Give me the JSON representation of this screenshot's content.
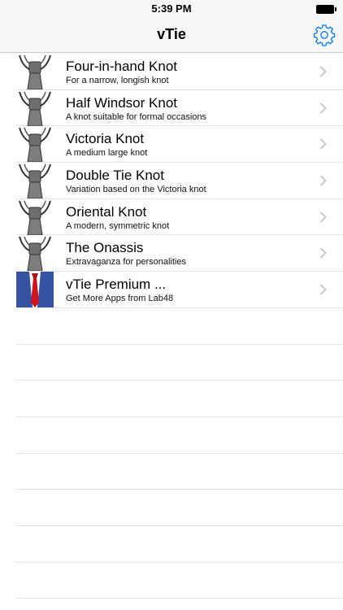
{
  "status_bar": {
    "time": "5:39 PM",
    "battery_icon": "battery-full-icon"
  },
  "nav_bar": {
    "title": "vTie",
    "settings_icon": "gear-icon"
  },
  "knots": [
    {
      "title": "Four-in-hand Knot",
      "subtitle": "For a narrow, longish knot",
      "icon": "tie-knot-icon"
    },
    {
      "title": "Half Windsor Knot",
      "subtitle": "A knot suitable for formal occasions",
      "icon": "tie-knot-icon"
    },
    {
      "title": "Victoria Knot",
      "subtitle": "A medium large knot",
      "icon": "tie-knot-icon"
    },
    {
      "title": "Double Tie Knot",
      "subtitle": "Variation based on the Victoria knot",
      "icon": "tie-knot-icon"
    },
    {
      "title": "Oriental Knot",
      "subtitle": "A modern, symmetric knot",
      "icon": "tie-knot-icon"
    },
    {
      "title": "The Onassis",
      "subtitle": "Extravaganza for personalities",
      "icon": "tie-knot-icon"
    },
    {
      "title": "vTie Premium ...",
      "subtitle": "Get More Apps from Lab48",
      "icon": "suit-red-tie-icon"
    }
  ],
  "colors": {
    "accent": "#007aff",
    "bar_background": "#f7f7f7",
    "separator": "#e3e3e6",
    "chevron": "#c7c7cc"
  }
}
